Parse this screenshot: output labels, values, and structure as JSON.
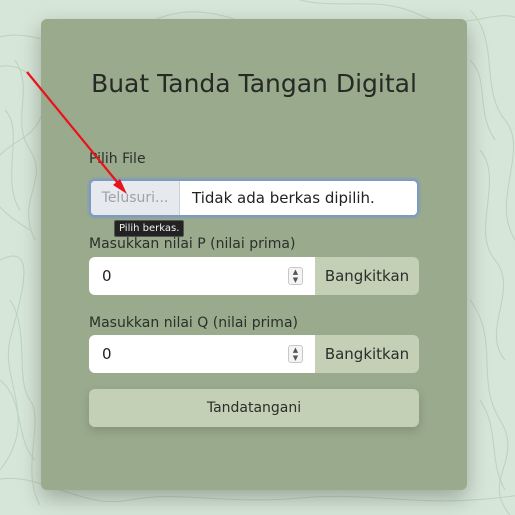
{
  "page": {
    "title": "Buat Tanda Tangan Digital"
  },
  "file_section": {
    "label": "Pilih File",
    "browse_label": "Telusuri...",
    "status_text": "Tidak ada berkas dipilih.",
    "tooltip": "Pilih berkas."
  },
  "p_section": {
    "label": "Masukkan nilai P (nilai prima)",
    "value": "0",
    "generate_label": "Bangkitkan"
  },
  "q_section": {
    "label": "Masukkan nilai Q (nilai prima)",
    "value": "0",
    "generate_label": "Bangkitkan"
  },
  "sign_button": {
    "label": "Tandatangani"
  },
  "colors": {
    "background": "#d6e6d8",
    "card": "#9aaa8c",
    "button": "#c4d0b6",
    "focus_border": "#7d9ac3",
    "annotation_arrow": "#e8141c"
  },
  "icons": {
    "spinner": "number-spinner-icon",
    "arrow": "red-arrow-annotation"
  }
}
